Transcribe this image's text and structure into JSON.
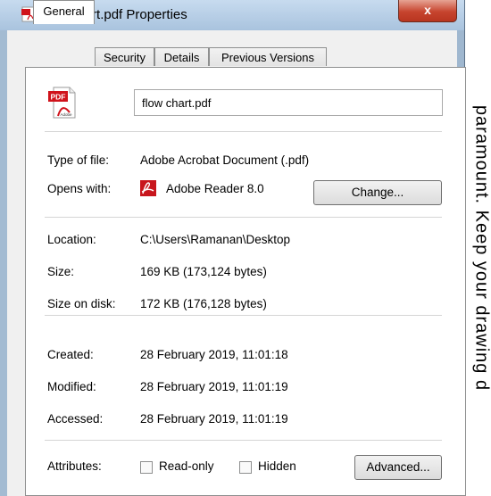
{
  "window": {
    "title": "flow chart.pdf Properties",
    "close_glyph": "x"
  },
  "tabs": [
    {
      "label": "General"
    },
    {
      "label": "Security"
    },
    {
      "label": "Details"
    },
    {
      "label": "Previous Versions"
    }
  ],
  "file": {
    "name": "flow chart.pdf",
    "icon": "pdf-file-icon",
    "icon_label": "PDF",
    "icon_sublabel": "Adobe"
  },
  "rows": {
    "type": {
      "label": "Type of file:",
      "value": "Adobe Acrobat Document (.pdf)"
    },
    "opens": {
      "label": "Opens with:",
      "value": "Adobe Reader 8.0",
      "button": "Change..."
    },
    "location": {
      "label": "Location:",
      "value": "C:\\Users\\Ramanan\\Desktop"
    },
    "size": {
      "label": "Size:",
      "value": "169 KB (173,124 bytes)"
    },
    "size_disk": {
      "label": "Size on disk:",
      "value": "172 KB (176,128 bytes)"
    },
    "created": {
      "label": "Created:",
      "value": "28 February 2019, 11:01:18"
    },
    "modified": {
      "label": "Modified:",
      "value": "28 February 2019, 11:01:19"
    },
    "accessed": {
      "label": "Accessed:",
      "value": "28 February 2019, 11:01:19"
    },
    "attributes": {
      "label": "Attributes:",
      "readonly": "Read-only",
      "hidden": "Hidden",
      "button": "Advanced..."
    }
  },
  "side_text": "paramount. Keep your drawing d",
  "colors": {
    "title_bg": "#b8cfe7",
    "close": "#c7442e",
    "pdf_red": "#d0121b"
  }
}
